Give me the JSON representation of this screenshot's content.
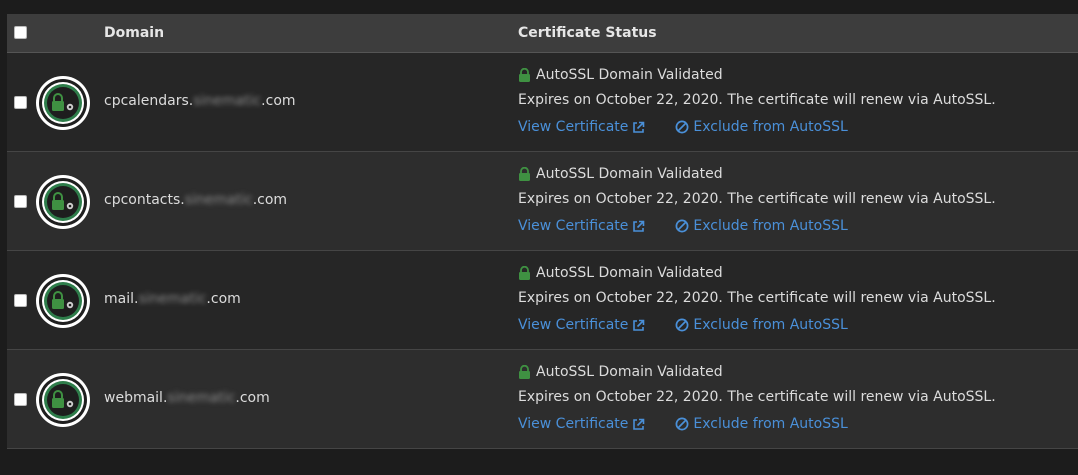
{
  "header": {
    "domain_label": "Domain",
    "status_label": "Certificate Status"
  },
  "colors": {
    "lock_green": "#3f9142",
    "link_blue": "#4a90d9",
    "badge_ring_green": "#2e7d4a"
  },
  "rows": [
    {
      "domain_prefix": "cpcalendars.",
      "domain_blurred": "sinematic",
      "domain_suffix": ".com",
      "status": "AutoSSL Domain Validated",
      "expires": "Expires on October 22, 2020. The certificate will renew via AutoSSL.",
      "view_label": "View Certificate",
      "exclude_label": "Exclude from AutoSSL"
    },
    {
      "domain_prefix": "cpcontacts.",
      "domain_blurred": "sinematic",
      "domain_suffix": ".com",
      "status": "AutoSSL Domain Validated",
      "expires": "Expires on October 22, 2020. The certificate will renew via AutoSSL.",
      "view_label": "View Certificate",
      "exclude_label": "Exclude from AutoSSL"
    },
    {
      "domain_prefix": "mail.",
      "domain_blurred": "sinematic",
      "domain_suffix": ".com",
      "status": "AutoSSL Domain Validated",
      "expires": "Expires on October 22, 2020. The certificate will renew via AutoSSL.",
      "view_label": "View Certificate",
      "exclude_label": "Exclude from AutoSSL"
    },
    {
      "domain_prefix": "webmail.",
      "domain_blurred": "sinematic",
      "domain_suffix": ".com",
      "status": "AutoSSL Domain Validated",
      "expires": "Expires on October 22, 2020. The certificate will renew via AutoSSL.",
      "view_label": "View Certificate",
      "exclude_label": "Exclude from AutoSSL"
    }
  ]
}
